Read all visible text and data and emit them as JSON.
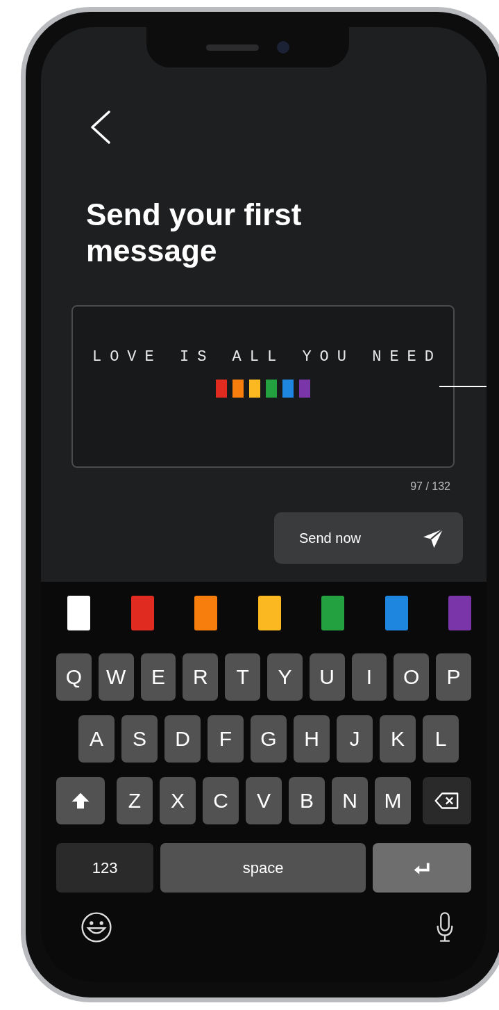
{
  "title": "Send your first message",
  "message": {
    "text": "LOVE IS ALL YOU NEED",
    "marks": [
      {
        "color": "#e02b20"
      },
      {
        "color": "#f77d0c"
      },
      {
        "color": "#fbb820"
      },
      {
        "color": "#23a141"
      },
      {
        "color": "#1f86e0"
      },
      {
        "color": "#7a35a8"
      }
    ]
  },
  "counter": "97 / 132",
  "send_button": {
    "label": "Send now"
  },
  "swatches": [
    {
      "color": "#ffffff"
    },
    {
      "color": "#e02b20"
    },
    {
      "color": "#f77d0c"
    },
    {
      "color": "#fbb820"
    },
    {
      "color": "#23a141"
    },
    {
      "color": "#1f86e0"
    },
    {
      "color": "#7a35a8"
    }
  ],
  "keyboard": {
    "rows": [
      [
        "Q",
        "W",
        "E",
        "R",
        "T",
        "Y",
        "U",
        "I",
        "O",
        "P"
      ],
      [
        "A",
        "S",
        "D",
        "F",
        "G",
        "H",
        "J",
        "K",
        "L"
      ],
      [
        "Z",
        "X",
        "C",
        "V",
        "B",
        "N",
        "M"
      ]
    ],
    "numbers_key": "123",
    "space_key": "space"
  }
}
